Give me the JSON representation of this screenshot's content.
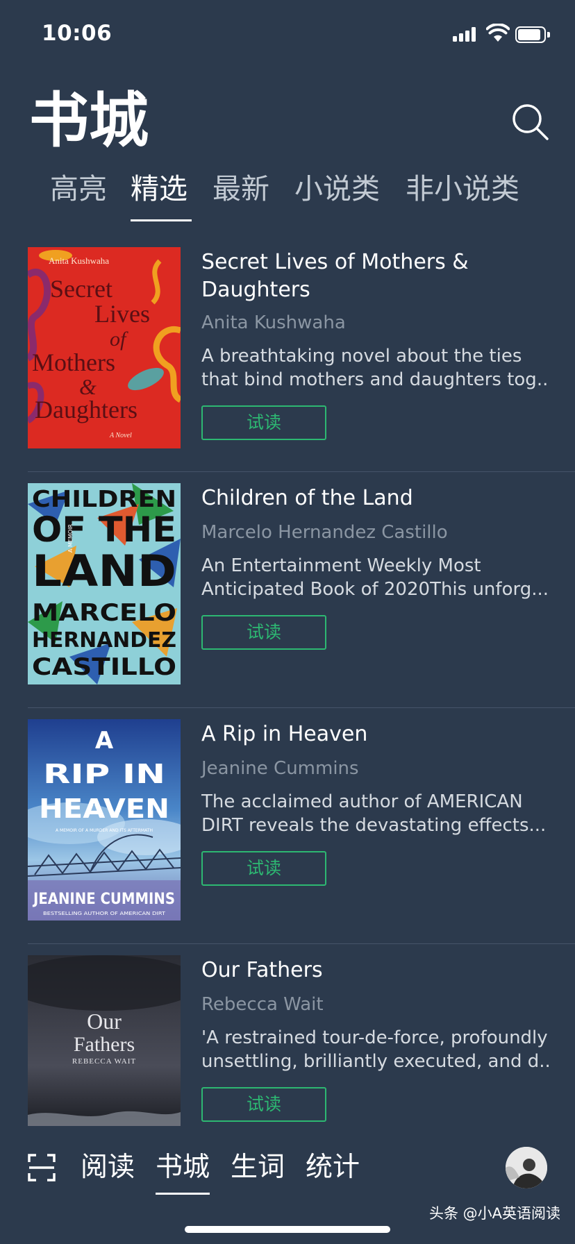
{
  "status_bar": {
    "time": "10:06"
  },
  "header": {
    "title": "书城"
  },
  "tabs": [
    {
      "label": "高亮",
      "active": false
    },
    {
      "label": "精选",
      "active": true
    },
    {
      "label": "最新",
      "active": false
    },
    {
      "label": "小说类",
      "active": false
    },
    {
      "label": "非小说类",
      "active": false
    }
  ],
  "books": [
    {
      "title": "Secret Lives of Mothers & Daughters",
      "author": "Anita Kushwaha",
      "desc_line1": "A breathtaking novel about the ties",
      "desc_line2": "that bind mothers and daughters tog...",
      "button": "试读",
      "cover": {
        "author": "Anita Kushwaha",
        "w1": "Secret",
        "w2": "Lives",
        "w3": "of",
        "w4": "Mothers",
        "w5": "&",
        "w6": "Daughters",
        "foot": "A Novel"
      }
    },
    {
      "title": "Children of the Land",
      "author": "Marcelo Hernandez Castillo",
      "desc_line1": "An Entertainment Weekly Most",
      "desc_line2": "Anticipated Book of 2020This unforg...",
      "button": "试读",
      "cover": {
        "l1": "CHILDREN",
        "l2": "OF THE",
        "l3": "LAND",
        "l4": "MARCELO",
        "l5": "HERNANDEZ",
        "l6": "CASTILLO",
        "tag": "A MEMOIR"
      }
    },
    {
      "title": "A Rip in Heaven",
      "author": "Jeanine Cummins",
      "desc_line1": "The acclaimed author of AMERICAN",
      "desc_line2": "DIRT reveals the devastating effects...",
      "button": "试读",
      "cover": {
        "l1": "A",
        "l2": "RIP IN",
        "l3": "HEAVEN",
        "sub": "A MEMOIR OF A MURDER AND ITS AFTERMATH",
        "author": "JEANINE CUMMINS",
        "foot": "BESTSELLING AUTHOR OF AMERICAN DIRT"
      }
    },
    {
      "title": "Our Fathers",
      "author": "Rebecca Wait",
      "desc_line1": "'A restrained tour-de-force, profoundly",
      "desc_line2": "unsettling, brilliantly executed, and d...",
      "button": "试读",
      "cover": {
        "l1": "Our",
        "l2": "Fathers",
        "author": "REBECCA WAIT"
      }
    }
  ],
  "bottom_nav": {
    "items": [
      {
        "label": "阅读",
        "active": false
      },
      {
        "label": "书城",
        "active": true
      },
      {
        "label": "生词",
        "active": false
      },
      {
        "label": "统计",
        "active": false
      }
    ]
  },
  "watermark": "头条 @小A英语阅读",
  "colors": {
    "background": "#2c3a4d",
    "accent_green": "#2db872",
    "author_gray": "#8b96a3"
  }
}
